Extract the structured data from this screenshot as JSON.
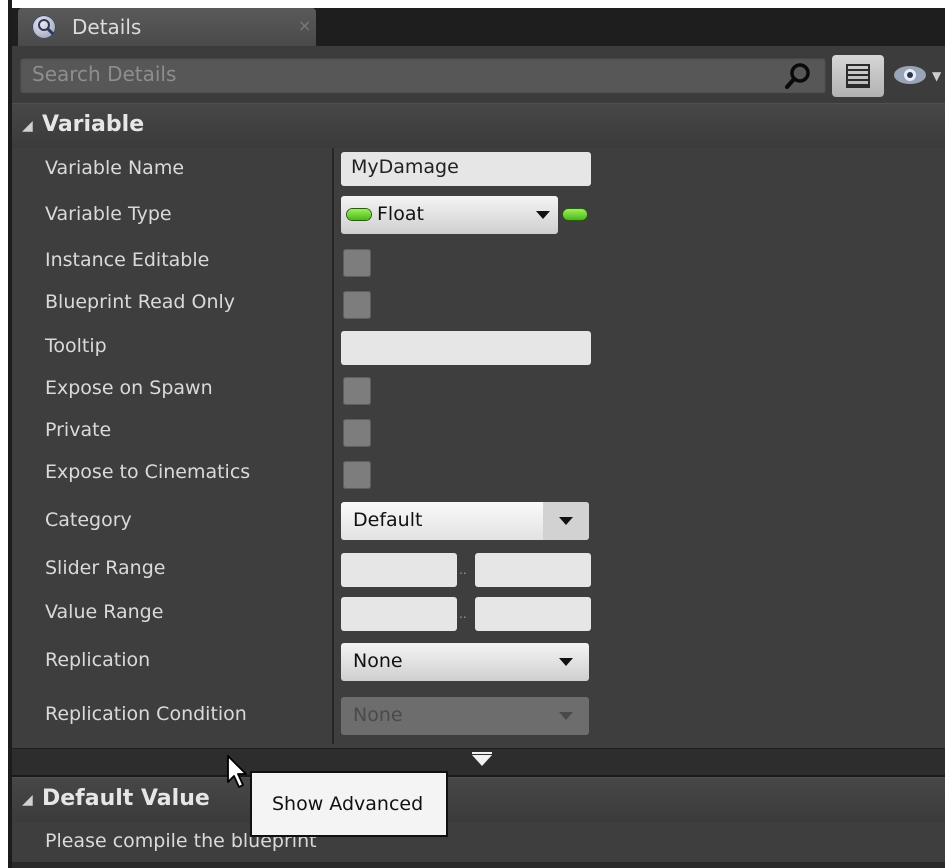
{
  "tab": {
    "title": "Details",
    "close": "×",
    "icon": "details-magnifier-icon"
  },
  "toolbar": {
    "search_placeholder": "Search Details",
    "icons": [
      "search-icon",
      "property-matrix-icon",
      "visibility-eye-icon"
    ]
  },
  "variable_section": {
    "title": "Variable",
    "rows": {
      "variable_name": {
        "label": "Variable Name",
        "value": "MyDamage"
      },
      "variable_type": {
        "label": "Variable Type",
        "value": "Float",
        "pin_color": "#6fd82e"
      },
      "instance_editable": {
        "label": "Instance Editable",
        "checked": false
      },
      "blueprint_read_only": {
        "label": "Blueprint Read Only",
        "checked": false
      },
      "tooltip": {
        "label": "Tooltip",
        "value": ""
      },
      "expose_on_spawn": {
        "label": "Expose on Spawn",
        "checked": false
      },
      "private": {
        "label": "Private",
        "checked": false
      },
      "expose_to_cinematics": {
        "label": "Expose to Cinematics",
        "checked": false
      },
      "category": {
        "label": "Category",
        "value": "Default"
      },
      "slider_range": {
        "label": "Slider Range",
        "separator": "..",
        "min": "",
        "max": ""
      },
      "value_range": {
        "label": "Value Range",
        "separator": "..",
        "min": "",
        "max": ""
      },
      "replication": {
        "label": "Replication",
        "value": "None"
      },
      "replication_condition": {
        "label": "Replication Condition",
        "value": "None",
        "disabled": true
      }
    }
  },
  "default_value_section": {
    "title": "Default Value",
    "message": "Please compile the blueprint"
  },
  "tooltip_popup": {
    "text": "Show Advanced"
  }
}
